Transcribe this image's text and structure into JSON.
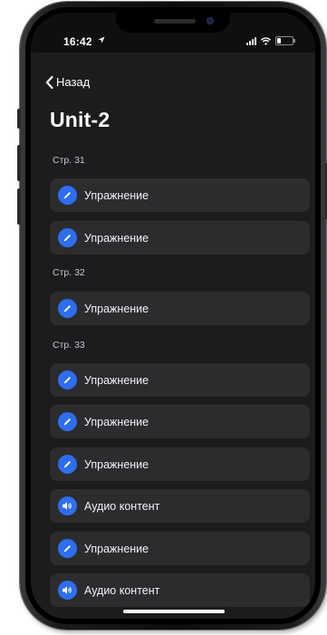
{
  "status_bar": {
    "time": "16:42"
  },
  "nav": {
    "back_label": "Назад"
  },
  "page": {
    "title": "Unit-2"
  },
  "sections": [
    {
      "header": "Стр. 31",
      "items": [
        {
          "label": "Упражнение",
          "icon": "pencil-icon"
        },
        {
          "label": "Упражнение",
          "icon": "pencil-icon"
        }
      ]
    },
    {
      "header": "Стр. 32",
      "items": [
        {
          "label": "Упражнение",
          "icon": "pencil-icon"
        }
      ]
    },
    {
      "header": "Стр. 33",
      "items": [
        {
          "label": "Упражнение",
          "icon": "pencil-icon"
        },
        {
          "label": "Упражнение",
          "icon": "pencil-icon"
        },
        {
          "label": "Упражнение",
          "icon": "pencil-icon"
        },
        {
          "label": "Аудио контент",
          "icon": "speaker-icon"
        },
        {
          "label": "Упражнение",
          "icon": "pencil-icon"
        },
        {
          "label": "Аудио контент",
          "icon": "speaker-icon"
        }
      ]
    }
  ],
  "colors": {
    "background": "#1c1c1e",
    "row_background": "#2c2c2e",
    "accent": "#2d6ef0",
    "text": "#ffffff",
    "section_header": "#c7c7cc"
  }
}
